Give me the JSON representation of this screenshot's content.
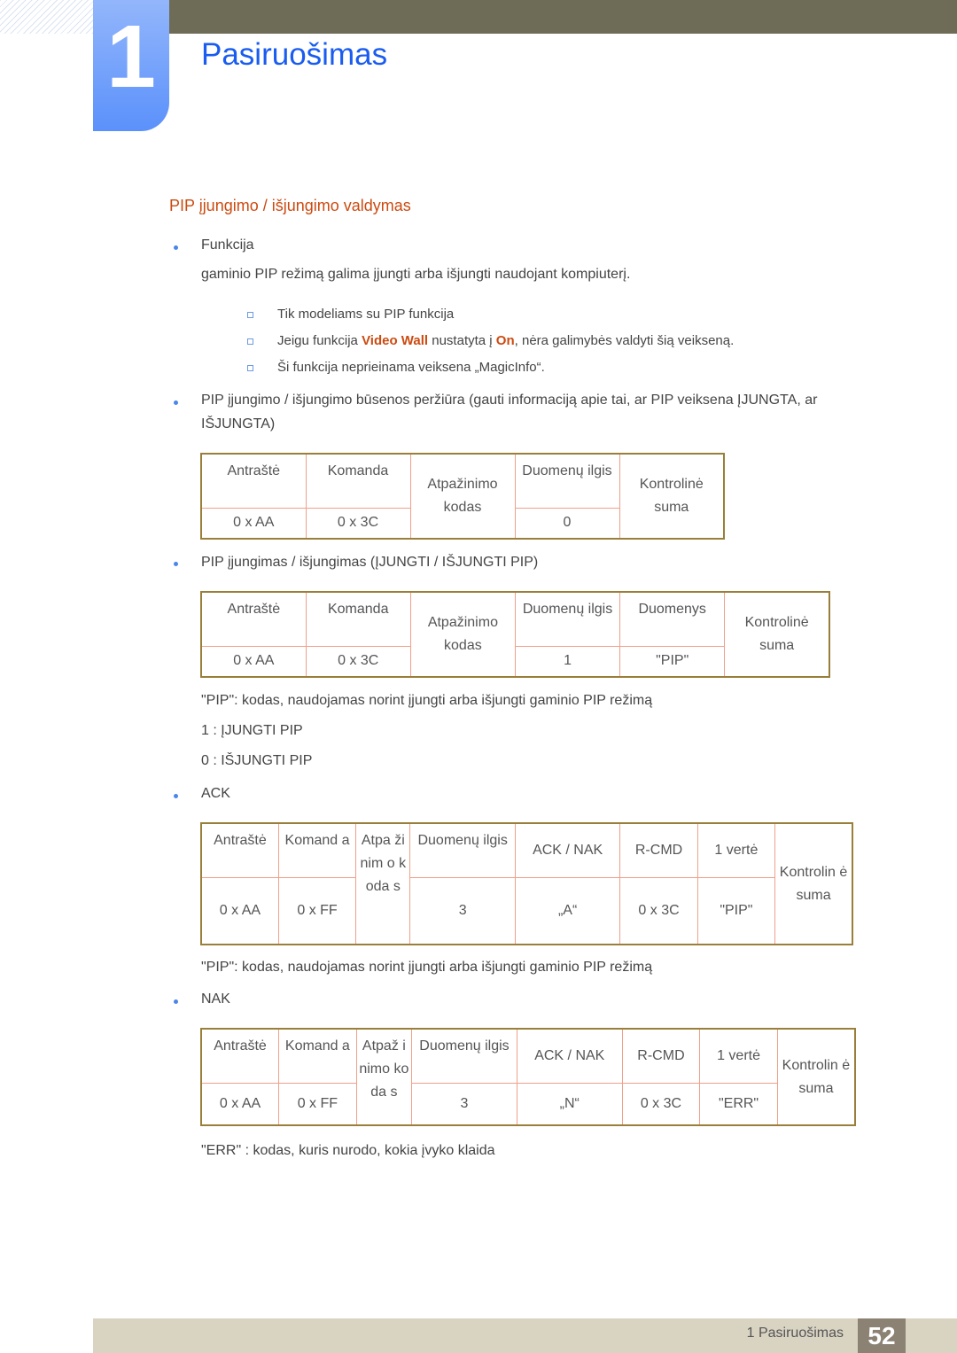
{
  "chapter": {
    "number": "1",
    "title": "Pasiruošimas"
  },
  "section_title": "PIP įjungimo / išjungimo valdymas",
  "function_block": {
    "bullet": "Funkcija",
    "description": "gaminio PIP režimą galima įjungti arba išjungti naudojant kompiuterį.",
    "notes": {
      "note1": "Tik modeliams su PIP funkcija",
      "note2_pre": "Jeigu funkcija ",
      "note2_hl1": "Video Wall",
      "note2_mid": " nustatyta į ",
      "note2_hl2": "On",
      "note2_post": ", nėra galimybės valdyti šią veikseną.",
      "note3": "Ši funkcija neprieinama veiksena „MagicInfo“."
    }
  },
  "status_block": {
    "bullet_line1": "PIP įjungimo / išjungimo būsenos peržiūra (gauti informaciją apie tai, ar PIP veiksena ĮJUNGTA, ar",
    "bullet_line2": "IŠJUNGTA)",
    "table": {
      "h_header": "Antraštė",
      "h_command": "Komanda",
      "h_id": "Atpažinimo kodas",
      "h_len": "Duomenų ilgis",
      "h_checksum": "Kontrolinė suma",
      "v_header": "0 x AA",
      "v_command": "0 x 3C",
      "v_len": "0"
    }
  },
  "set_block": {
    "bullet": "PIP įjungimas / išjungimas (ĮJUNGTI / IŠJUNGTI PIP)",
    "table": {
      "h_header": "Antraštė",
      "h_command": "Komanda",
      "h_id": "Atpažinimo kodas",
      "h_len": "Duomenų ilgis",
      "h_data": "Duomenys",
      "h_checksum": "Kontrolinė suma",
      "v_header": "0 x AA",
      "v_command": "0 x 3C",
      "v_len": "1",
      "v_data": "\"PIP\""
    },
    "desc": "\"PIP\": kodas, naudojamas norint įjungti arba išjungti gaminio PIP režimą",
    "opt_on": "1 : ĮJUNGTI PIP",
    "opt_off": "0 : IŠJUNGTI PIP"
  },
  "ack_block": {
    "bullet": "ACK",
    "table": {
      "h_header": "Antraštė",
      "h_command": "Komand a",
      "h_id": "Atpa žinim o koda s",
      "h_len": "Duomenų ilgis",
      "h_acknak": "ACK / NAK",
      "h_rcmd": "R-CMD",
      "h_val1": "1 vertė",
      "h_checksum": "Kontrolin ė suma",
      "v_header": "0 x AA",
      "v_command": "0 x FF",
      "v_len": "3",
      "v_acknak": "„A“",
      "v_rcmd": "0 x 3C",
      "v_val1": "\"PIP\""
    },
    "desc": "\"PIP\": kodas, naudojamas norint įjungti arba išjungti gaminio PIP režimą"
  },
  "nak_block": {
    "bullet": "NAK",
    "table": {
      "h_header": "Antraštė",
      "h_command": "Komand a",
      "h_id": "Atpaž inimo koda s",
      "h_len": "Duomenų ilgis",
      "h_acknak": "ACK / NAK",
      "h_rcmd": "R-CMD",
      "h_val1": "1 vertė",
      "h_checksum": "Kontrolin ė suma",
      "v_header": "0 x AA",
      "v_command": "0 x FF",
      "v_len": "3",
      "v_acknak": "„N“",
      "v_rcmd": "0 x 3C",
      "v_val1": "\"ERR\""
    },
    "desc": "\"ERR\" : kodas, kuris nurodo, kokia įvyko klaida"
  },
  "footer": {
    "label": "1 Pasiruošimas",
    "page": "52"
  }
}
